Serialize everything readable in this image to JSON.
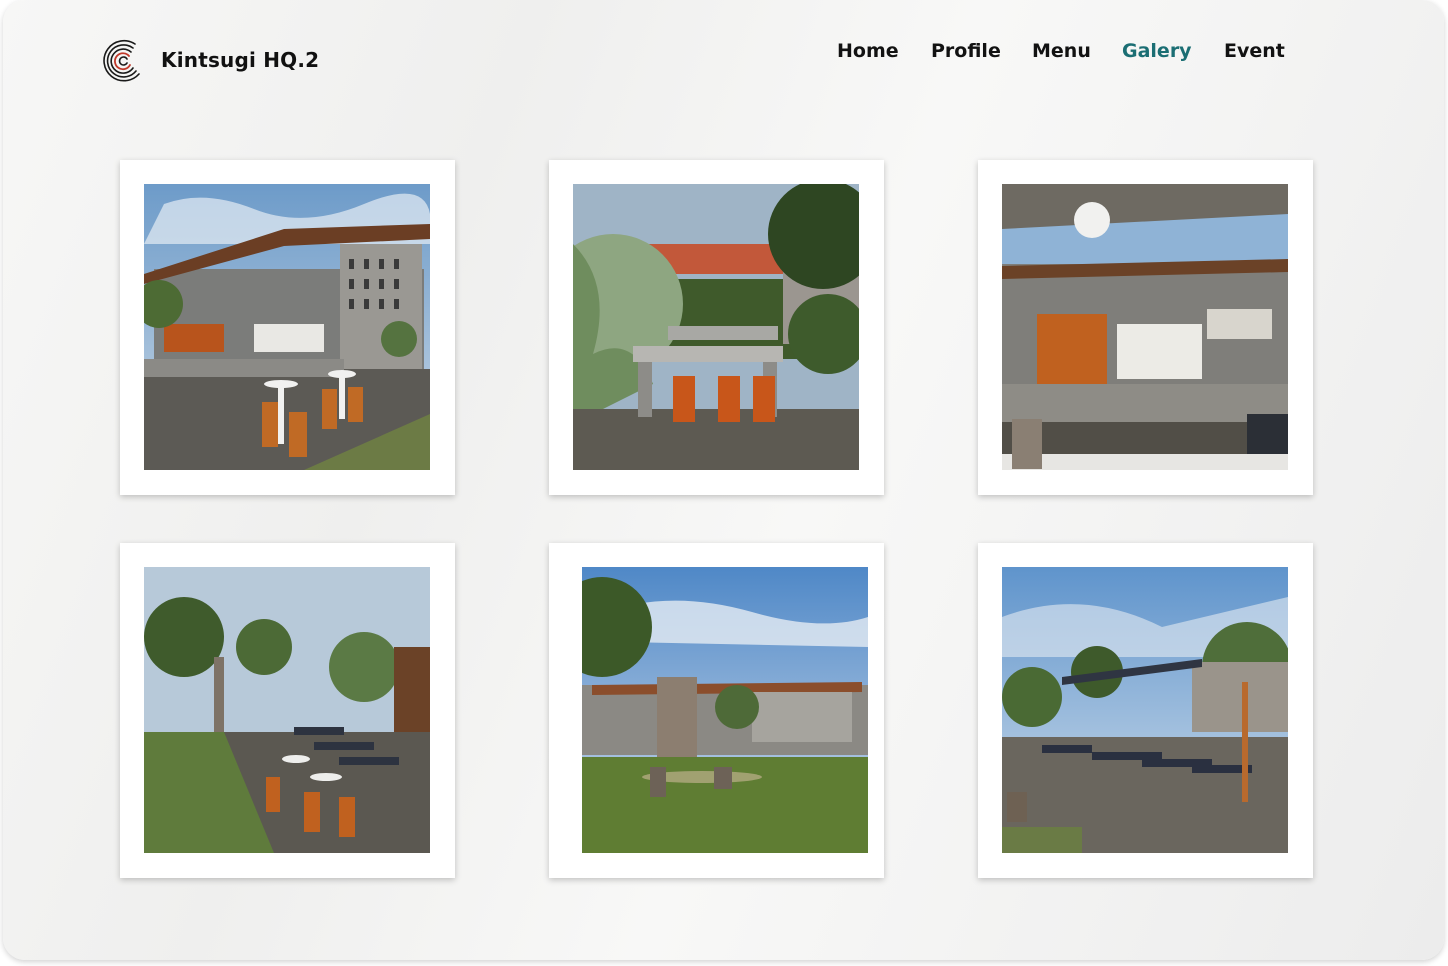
{
  "brand": {
    "name": "Kintsugi HQ.2"
  },
  "nav": {
    "items": [
      {
        "label": "Home"
      },
      {
        "label": "Profile"
      },
      {
        "label": "Menu"
      },
      {
        "label": "Galery",
        "active": true
      },
      {
        "label": "Event"
      }
    ],
    "active_color": "#1b6e73"
  },
  "gallery": {
    "photos": [
      {
        "subject": "cafe-pavilion-with-bar-stools"
      },
      {
        "subject": "concrete-table-with-orange-stools-in-garden"
      },
      {
        "subject": "cafe-counter-under-roof"
      },
      {
        "subject": "gravel-path-with-tables-and-trees"
      },
      {
        "subject": "lawn-with-tree-stump-and-pavilion"
      },
      {
        "subject": "outdoor-seating-area-under-trees"
      }
    ]
  }
}
